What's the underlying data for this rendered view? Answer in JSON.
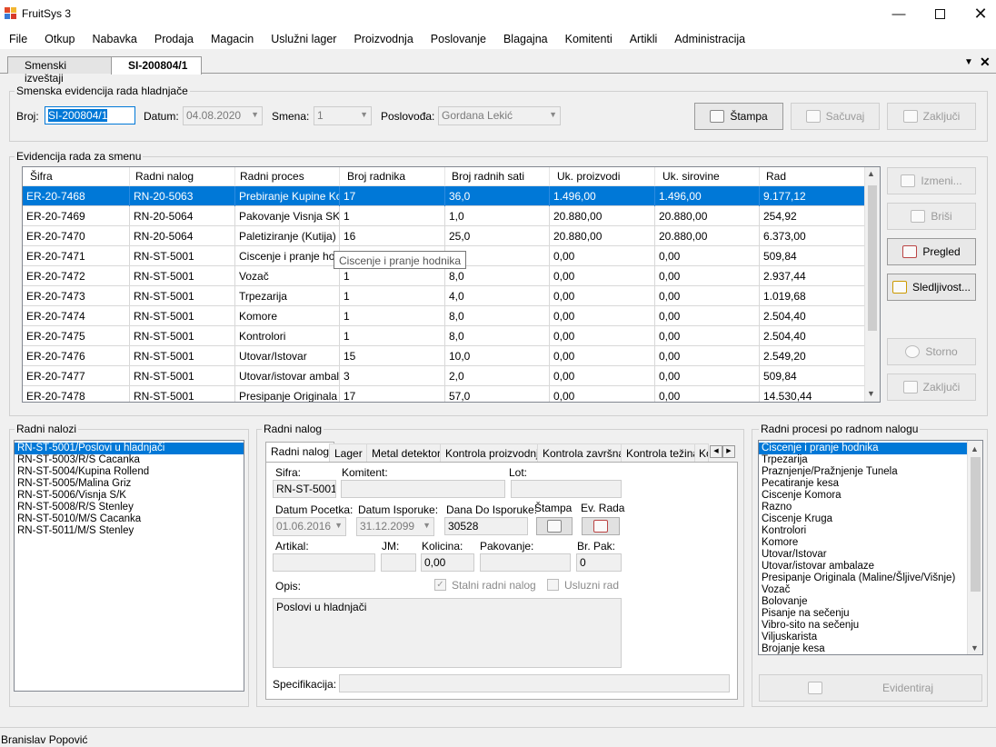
{
  "window": {
    "title": "FruitSys 3"
  },
  "menu": [
    "File",
    "Otkup",
    "Nabavka",
    "Prodaja",
    "Magacin",
    "Uslužni lager",
    "Proizvodnja",
    "Poslovanje",
    "Blagajna",
    "Komitenti",
    "Artikli",
    "Administracija"
  ],
  "doc_tabs": [
    "Smenski izveštaji",
    "SI-200804/1"
  ],
  "header_group": {
    "title": "Smenska evidencija rada hladnjače",
    "broj_label": "Broj:",
    "broj_value": "SI-200804/1",
    "datum_label": "Datum:",
    "datum_value": "04.08.2020",
    "smena_label": "Smena:",
    "smena_value": "1",
    "poslovodja_label": "Poslovođa:",
    "poslovodja_value": "Gordana Lekić",
    "stampa_label": "Štampa",
    "sacuvaj_label": "Sačuvaj",
    "zakljuci_label": "Zaključi"
  },
  "grid_group": {
    "title": "Evidencija rada za smenu",
    "columns": [
      "Šifra",
      "Radni nalog",
      "Radni proces",
      "Broj radnika",
      "Broj radnih sati",
      "Uk. proizvodi",
      "Uk. sirovine",
      "Rad"
    ],
    "rows": [
      [
        "ER-20-7468",
        "RN-20-5063",
        "Prebiranje Kupine Ko...",
        "17",
        "36,0",
        "1.496,00",
        "1.496,00",
        "9.177,12"
      ],
      [
        "ER-20-7469",
        "RN-20-5064",
        "Pakovanje Visnja SK...",
        "1",
        "1,0",
        "20.880,00",
        "20.880,00",
        "254,92"
      ],
      [
        "ER-20-7470",
        "RN-20-5064",
        "Paletiziranje (Kutija)",
        "16",
        "25,0",
        "20.880,00",
        "20.880,00",
        "6.373,00"
      ],
      [
        "ER-20-7471",
        "RN-ST-5001",
        "Ciscenje i pranje hod...",
        "",
        "",
        "0,00",
        "0,00",
        "509,84"
      ],
      [
        "ER-20-7472",
        "RN-ST-5001",
        "Vozač",
        "1",
        "8,0",
        "0,00",
        "0,00",
        "2.937,44"
      ],
      [
        "ER-20-7473",
        "RN-ST-5001",
        "Trpezarija",
        "1",
        "4,0",
        "0,00",
        "0,00",
        "1.019,68"
      ],
      [
        "ER-20-7474",
        "RN-ST-5001",
        "Komore",
        "1",
        "8,0",
        "0,00",
        "0,00",
        "2.504,40"
      ],
      [
        "ER-20-7475",
        "RN-ST-5001",
        "Kontrolori",
        "1",
        "8,0",
        "0,00",
        "0,00",
        "2.504,40"
      ],
      [
        "ER-20-7476",
        "RN-ST-5001",
        "Utovar/Istovar",
        "15",
        "10,0",
        "0,00",
        "0,00",
        "2.549,20"
      ],
      [
        "ER-20-7477",
        "RN-ST-5001",
        "Utovar/istovar ambal...",
        "3",
        "2,0",
        "0,00",
        "0,00",
        "509,84"
      ],
      [
        "ER-20-7478",
        "RN-ST-5001",
        "Presipanje Originala (...",
        "17",
        "57,0",
        "0,00",
        "0,00",
        "14.530,44"
      ]
    ],
    "tooltip": "Ciscenje i pranje hodnika",
    "side_buttons": {
      "izmeni": "Izmeni...",
      "brisi": "Briši",
      "pregled": "Pregled",
      "sledljivost": "Sledljivost...",
      "storno": "Storno",
      "zakljuci": "Zaključi"
    }
  },
  "radni_nalozi": {
    "title": "Radni nalozi",
    "items": [
      "RN-ST-5001/Poslovi u hladnjači",
      "RN-ST-5003/R/S Cacanka",
      "RN-ST-5004/Kupina Rollend",
      "RN-ST-5005/Malina Griz",
      "RN-ST-5006/Visnja S/K",
      "RN-ST-5008/R/S Stenley",
      "RN-ST-5010/M/S Cacanka",
      "RN-ST-5011/M/S Stenley"
    ]
  },
  "radni_nalog": {
    "title": "Radni nalog",
    "tabs": [
      "Radni nalog",
      "Lager",
      "Metal detektor",
      "Kontrola proizvodnja",
      "Kontrola završna",
      "Kontrola težina",
      "Ko"
    ],
    "sifra_label": "Sifra:",
    "sifra_value": "RN-ST-5001",
    "komitent_label": "Komitent:",
    "lot_label": "Lot:",
    "datum_pocetka_label": "Datum Pocetka:",
    "datum_pocetka_value": "01.06.2016",
    "datum_isporuke_label": "Datum Isporuke:",
    "datum_isporuke_value": "31.12.2099",
    "dana_label": "Dana Do Isporuke:",
    "dana_value": "30528",
    "stampa_label": "Štampa",
    "ev_rada_label": "Ev. Rada",
    "artikal_label": "Artikal:",
    "jm_label": "JM:",
    "kolicina_label": "Kolicina:",
    "kolicina_value": "0,00",
    "pakovanje_label": "Pakovanje:",
    "br_pak_label": "Br. Pak:",
    "br_pak_value": "0",
    "opis_label": "Opis:",
    "opis_value": "Poslovi u hladnjači",
    "stalni_label": "Stalni radni nalog",
    "usluzni_label": "Usluzni rad",
    "specifikacija_label": "Specifikacija:"
  },
  "procesi": {
    "title": "Radni procesi po radnom nalogu",
    "items": [
      "Ciscenje i pranje hodnika",
      "Trpezarija",
      "Praznjenje/Pražnjenje Tunela",
      "Pecatiranje kesa",
      "Ciscenje Komora",
      "Razno",
      "Ciscenje Kruga",
      "Kontrolori",
      "Komore",
      "Utovar/Istovar",
      "Utovar/istovar ambalaze",
      "Presipanje Originala (Maline/Šljive/Višnje)",
      "Vozač",
      "Bolovanje",
      "Pisanje na sečenju",
      "Vibro-sito na sečenju",
      "Viljuskarista",
      "Brojanje kesa"
    ],
    "evidentiraj_label": "Evidentiraj"
  },
  "status": {
    "user": "Branislav Popović"
  },
  "colors": {
    "selection": "#0078d7",
    "background": "#f0f0f0"
  }
}
